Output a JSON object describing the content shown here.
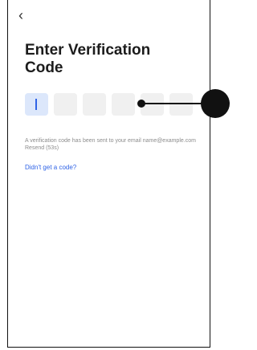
{
  "nav": {
    "back_icon": "chevron-left-icon",
    "back_glyph": "‹"
  },
  "page": {
    "title": "Enter Verification Code"
  },
  "code": {
    "length": 6,
    "active_index": 0,
    "values": [
      "",
      "",
      "",
      "",
      "",
      ""
    ]
  },
  "message": {
    "text": "A verification code has been sent to your email name@example.com Resend (53s)"
  },
  "help": {
    "label": "Didn't get a code?"
  },
  "colors": {
    "accent": "#2f63e6",
    "active_box": "#dce7fb",
    "box": "#f0f0f0",
    "muted": "#8c8c8c"
  }
}
